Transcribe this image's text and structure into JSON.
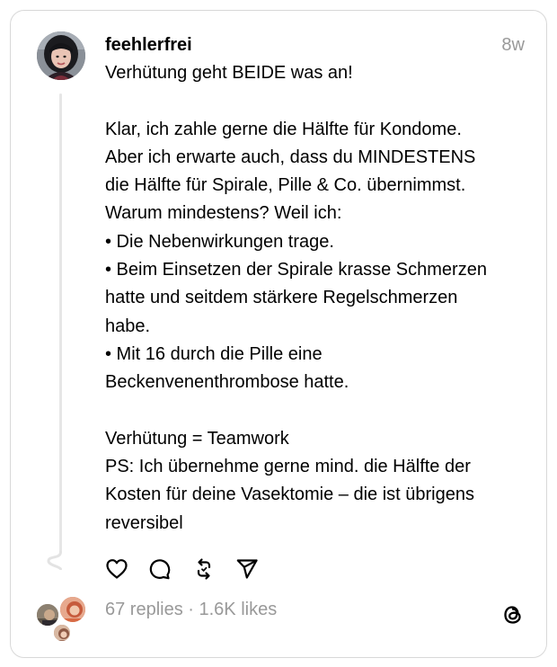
{
  "post": {
    "username": "feehlerfrei",
    "time": "8w",
    "lines": [
      "Verhütung geht BEIDE was an!",
      "",
      "Klar, ich zahle gerne die Hälfte für Kondome.",
      "Aber ich erwarte auch, dass du MINDESTENS",
      "die Hälfte für Spirale, Pille & Co. übernimmst.",
      "Warum mindestens? Weil ich:",
      "• Die Nebenwirkungen trage.",
      "• Beim Einsetzen der Spirale krasse Schmerzen",
      "hatte und seitdem stärkere Regelschmerzen",
      "habe.",
      "• Mit 16 durch die Pille eine",
      "Beckenvenenthrombose hatte.",
      "",
      "Verhütung = Teamwork",
      "PS: Ich übernehme gerne mind. die Hälfte der",
      "Kosten für deine Vasektomie – die ist übrigens",
      "reversibel"
    ]
  },
  "actions": {
    "like": "heart-icon",
    "reply": "comment-icon",
    "repost": "repost-icon",
    "share": "send-icon"
  },
  "footer": {
    "stats": "67 replies · 1.6K likes",
    "logo": "threads-logo-icon"
  },
  "colors": {
    "muted": "#999999",
    "border": "#d8d8d8",
    "line": "#e6e6e6"
  }
}
